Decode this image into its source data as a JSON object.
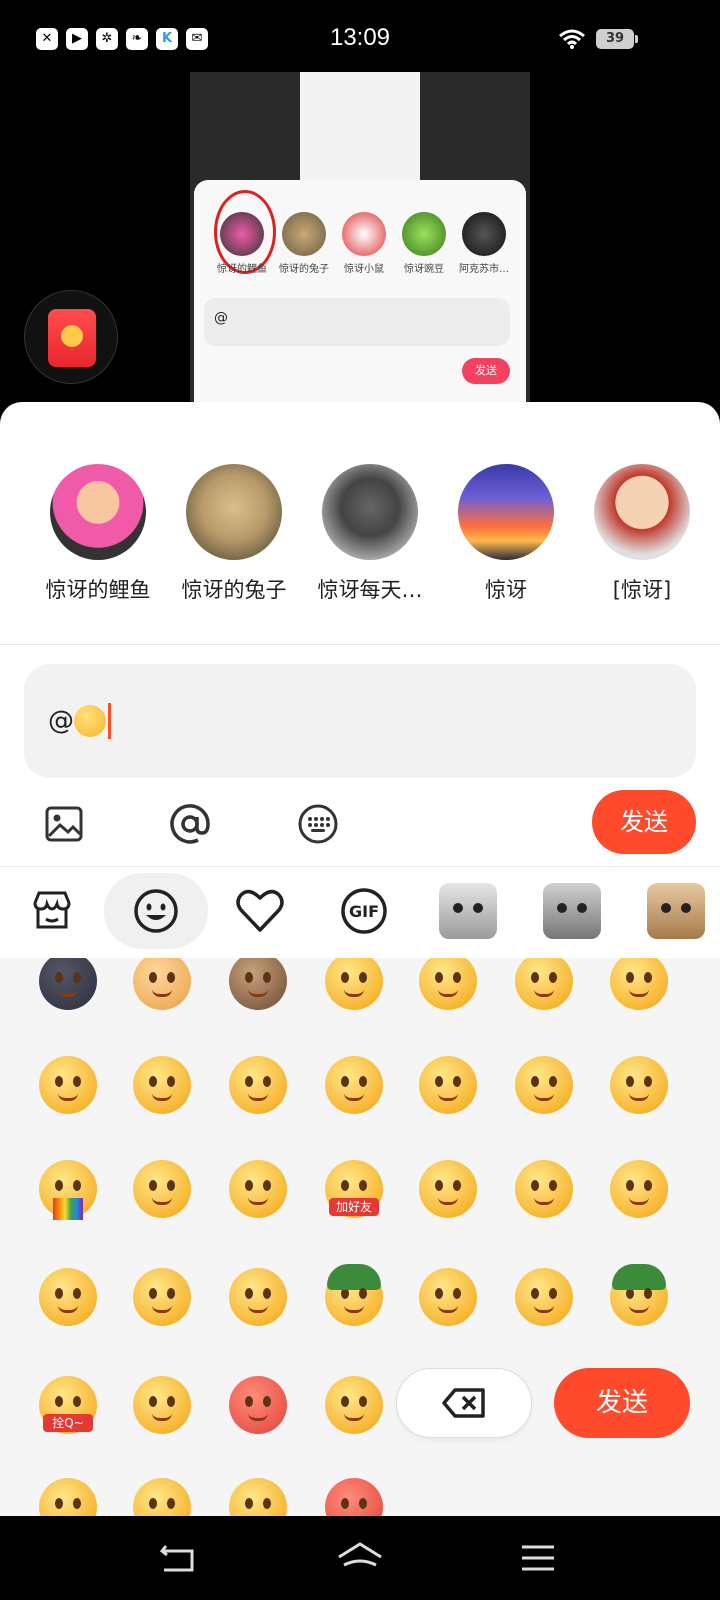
{
  "status_bar": {
    "time": "13:09",
    "battery": "39",
    "left_icons": [
      "x",
      "play",
      "pinwheel",
      "leaf",
      "K",
      "mail"
    ]
  },
  "background_screenshot": {
    "avatars": [
      "惊讶的鲤鱼",
      "惊讶的兔子",
      "惊讶小鼠",
      "惊讶豌豆",
      "阿克苏市…"
    ],
    "input_text": "@",
    "send_label": "发送"
  },
  "sticker_suggestions": [
    {
      "label": "惊讶的鲤鱼",
      "colors": [
        "#f05aa8",
        "#2b2b2b"
      ]
    },
    {
      "label": "惊讶的兔子",
      "colors": [
        "#b99a6b",
        "#6b5d40"
      ]
    },
    {
      "label": "惊讶每天…",
      "colors": [
        "#8a8a8a",
        "#333333"
      ]
    },
    {
      "label": "惊讶",
      "colors": [
        "#5b5bd6",
        "#ff8a3d"
      ]
    },
    {
      "label": "[惊讶]",
      "colors": [
        "#f6d2b5",
        "#c0392b"
      ]
    }
  ],
  "comment_input": {
    "value": "@"
  },
  "toolbar": {
    "send_label": "发送"
  },
  "tabs": [
    "store-icon",
    "smile-icon",
    "heart-icon",
    "gif-icon",
    "cat-sticker-1",
    "cat-sticker-2",
    "cat-sticker-3"
  ],
  "tab_gif_label": "GIF",
  "emoji_tags": {
    "add_friend": "加好友",
    "quan_q": "拴Q~"
  },
  "keyboard_actions": {
    "send_label": "发送"
  },
  "colors": {
    "accent": "#ff4a2b",
    "sheet_bg": "#ffffff",
    "grid_bg": "#f5f5f5"
  }
}
